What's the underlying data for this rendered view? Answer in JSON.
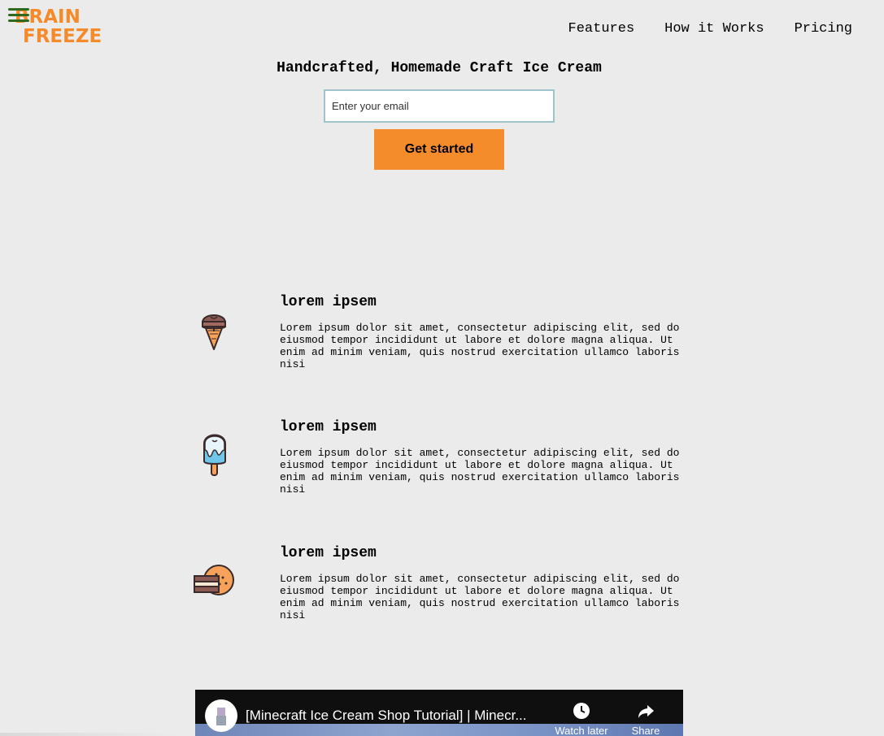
{
  "header": {
    "logo_line1": "BRAIN",
    "logo_line2": "FREEZE",
    "menu_icon": "hamburger-menu-icon",
    "nav": [
      {
        "label": "Features"
      },
      {
        "label": "How it Works"
      },
      {
        "label": "Pricing"
      }
    ]
  },
  "hero": {
    "title": "Handcrafted, Homemade Craft Ice Cream",
    "email_placeholder": "Enter your email",
    "email_value": "",
    "cta_label": "Get started"
  },
  "features": [
    {
      "icon": "ice-cream-cone-icon",
      "title": "lorem ipsem",
      "body": "Lorem ipsum dolor sit amet, consectetur adipiscing elit, sed do eiusmod tempor incididunt ut labore et dolore magna aliqua. Ut enim ad minim veniam, quis nostrud exercitation ullamco laboris nisi"
    },
    {
      "icon": "popsicle-icon",
      "title": "lorem ipsem",
      "body": "Lorem ipsum dolor sit amet, consectetur adipiscing elit, sed do eiusmod tempor incididunt ut labore et dolore magna aliqua. Ut enim ad minim veniam, quis nostrud exercitation ullamco laboris nisi"
    },
    {
      "icon": "ice-cream-sandwich-icon",
      "title": "lorem ipsem",
      "body": "Lorem ipsum dolor sit amet, consectetur adipiscing elit, sed do eiusmod tempor incididunt ut labore et dolore magna aliqua. Ut enim ad minim veniam, quis nostrud exercitation ullamco laboris nisi"
    }
  ],
  "video": {
    "title": "[Minecraft Ice Cream Shop Tutorial] | Minecr...",
    "watch_later_label": "Watch later",
    "share_label": "Share",
    "watch_later_icon": "clock-icon",
    "share_icon": "share-arrow-icon"
  },
  "colors": {
    "background": "#ebebeb",
    "accent": "#f58c2c",
    "menu": "#2d6a1f",
    "input_border": "#9ec3cc"
  }
}
